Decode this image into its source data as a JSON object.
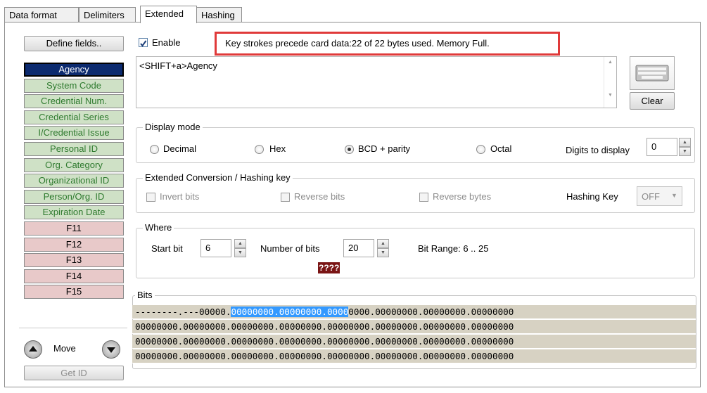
{
  "tabs": [
    "Data format",
    "Delimiters",
    "Extended",
    "Hashing"
  ],
  "left": {
    "define_fields": "Define fields..",
    "fields": [
      {
        "label": "Agency",
        "style": "selected"
      },
      {
        "label": "System Code",
        "style": "green"
      },
      {
        "label": "Credential Num.",
        "style": "green"
      },
      {
        "label": "Credential Series",
        "style": "green"
      },
      {
        "label": "I/Credential Issue",
        "style": "green"
      },
      {
        "label": "Personal ID",
        "style": "green"
      },
      {
        "label": "Org. Category",
        "style": "green"
      },
      {
        "label": "Organizational ID",
        "style": "green"
      },
      {
        "label": "Person/Org. ID",
        "style": "green"
      },
      {
        "label": "Expiration Date",
        "style": "green"
      },
      {
        "label": "F11",
        "style": "pink"
      },
      {
        "label": "F12",
        "style": "pink"
      },
      {
        "label": "F13",
        "style": "pink"
      },
      {
        "label": "F14",
        "style": "pink"
      },
      {
        "label": "F15",
        "style": "pink"
      }
    ],
    "move_label": "Move",
    "get_id": "Get ID"
  },
  "enable": {
    "label": "Enable",
    "checked": true
  },
  "status_message": "Key strokes precede card data:22 of 22 bytes used. Memory Full.",
  "keystrokes_text": "<SHIFT+a>Agency",
  "clear_label": "Clear",
  "display_mode": {
    "title": "Display mode",
    "options": [
      "Decimal",
      "Hex",
      "BCD + parity",
      "Octal"
    ],
    "selected": "BCD + parity",
    "digits_label": "Digits to display",
    "digits_value": "0"
  },
  "conversion": {
    "title": "Extended Conversion / Hashing key",
    "invert_bits": "Invert  bits",
    "reverse_bits": "Reverse bits",
    "reverse_bytes": "Reverse bytes",
    "hashing_key_label": "Hashing Key",
    "hashing_key_value": "OFF"
  },
  "where": {
    "title": "Where",
    "start_bit_label": "Start bit",
    "start_bit_value": "6",
    "num_bits_label": "Number of bits",
    "num_bits_value": "20",
    "bit_range": "Bit Range: 6 .. 25",
    "preview": "????"
  },
  "bits": {
    "title": "Bits",
    "row1_pre": "--------.---00000.",
    "row1_sel": "00000000.00000000.0000",
    "row1_post": "0000.00000000.00000000.00000000",
    "rows": [
      "00000000.00000000.00000000.00000000.00000000.00000000.00000000.00000000",
      "00000000.00000000.00000000.00000000.00000000.00000000.00000000.00000000",
      "00000000.00000000.00000000.00000000.00000000.00000000.00000000.00000000"
    ]
  }
}
